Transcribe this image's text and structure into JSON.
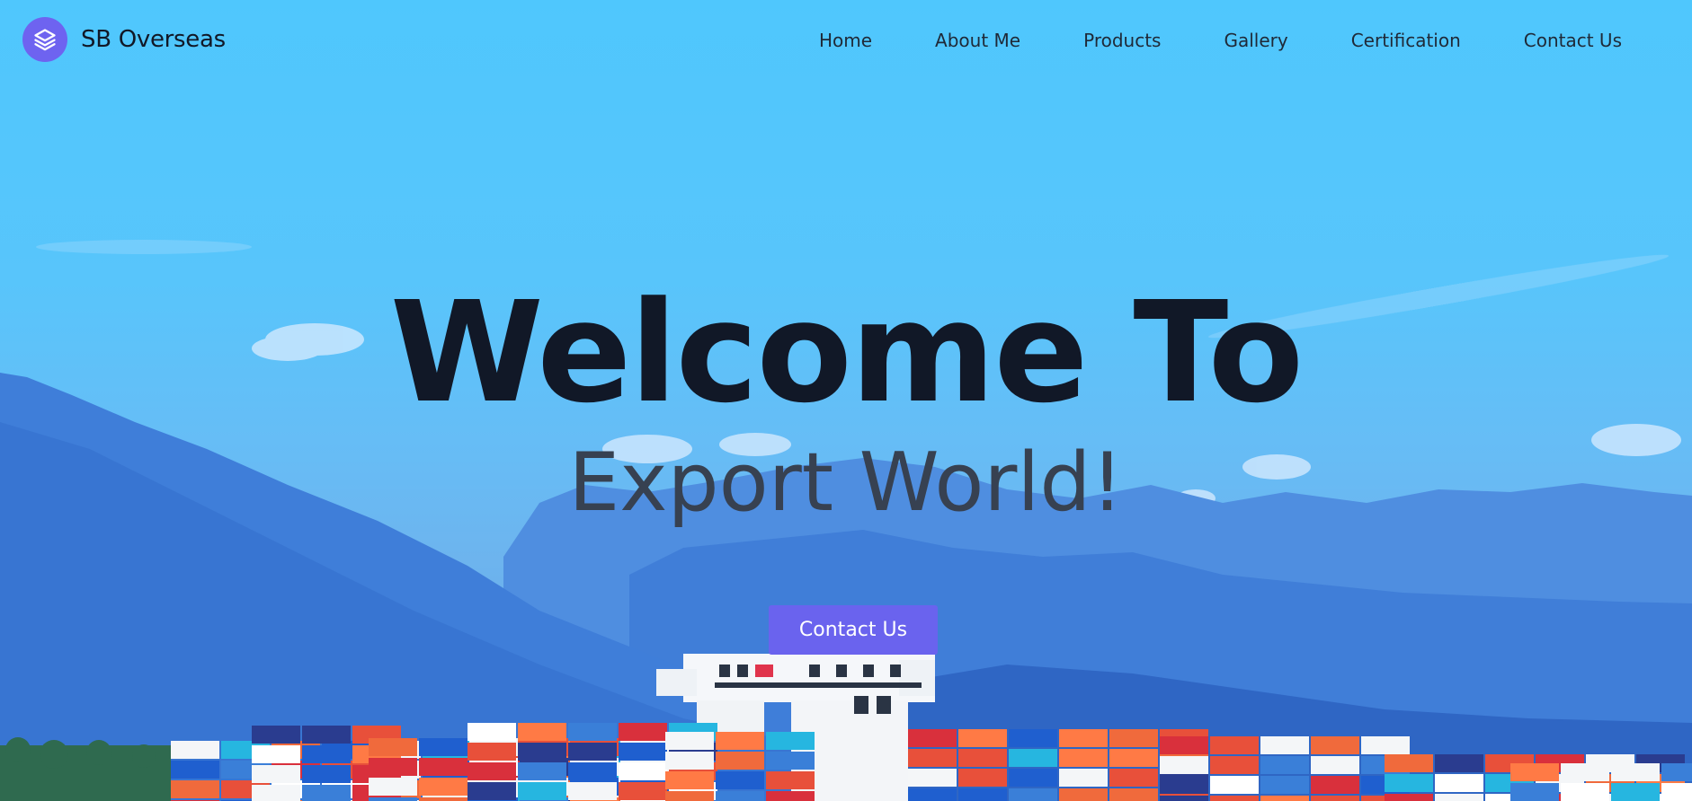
{
  "brand": {
    "name": "SB Overseas",
    "logo_icon": "stacked-layers-icon"
  },
  "nav": {
    "items": [
      {
        "label": "Home"
      },
      {
        "label": "About Me"
      },
      {
        "label": "Products"
      },
      {
        "label": "Gallery"
      },
      {
        "label": "Certification"
      },
      {
        "label": "Contact Us"
      }
    ]
  },
  "hero": {
    "title": "Welcome To",
    "subtitle": "Export World!",
    "cta_label": "Contact Us",
    "background": "container-ship-mountains-photo"
  },
  "colors": {
    "accent": "#6a63ee",
    "title": "#111827",
    "subtitle": "#374151",
    "sky": "#58c5fb"
  }
}
